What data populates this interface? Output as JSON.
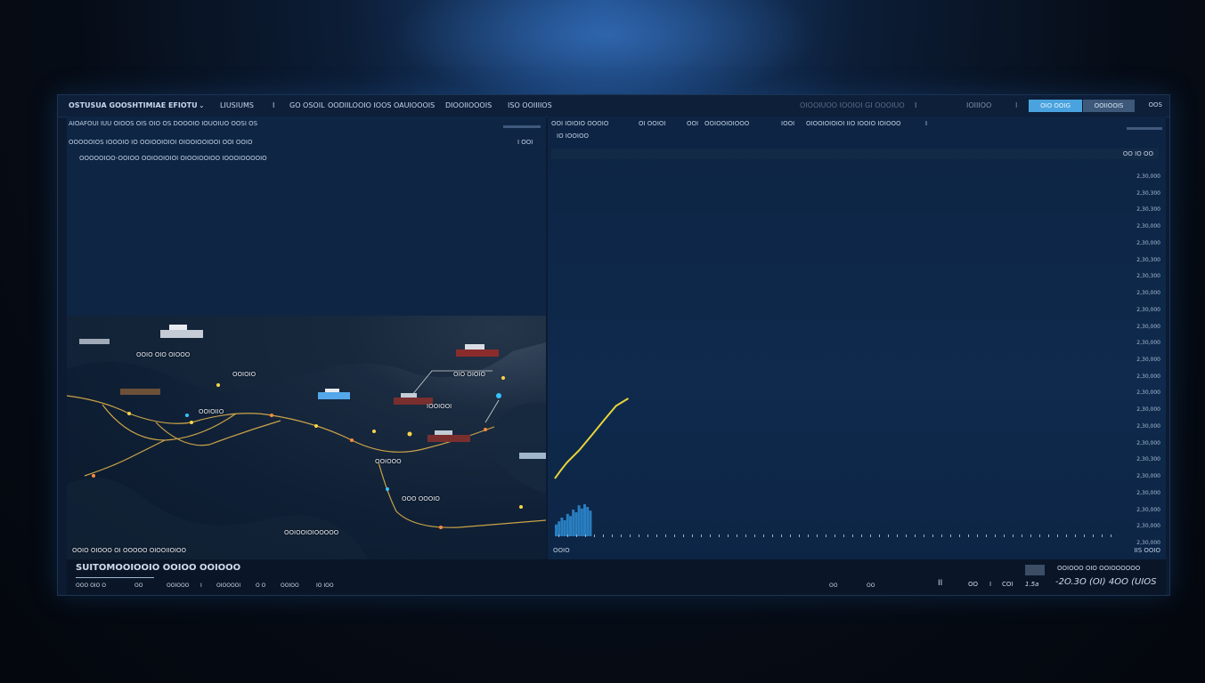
{
  "topbar": {
    "app_title": "OSTUSUA GOOSHTIMIAE EFIOTU",
    "menu_items": [
      "LIUSIUMS",
      "I",
      "GO OSOIL",
      "OODIILOOIO IOOS OAUIOOOIS",
      "DIOOIIOOOIS",
      "ISO OOIIIIOS"
    ],
    "right_status": "OIOOIUOO IOOIOI GI OOOIUO",
    "right_misc": [
      "I",
      "IOIIIOO",
      "I"
    ],
    "primary_button": "OIO OOIG",
    "secondary_button": "OOIIOOIS",
    "more_label": "OOS"
  },
  "left_panel": {
    "header": "AIOAFOUI IUU OIOOS OIS OIO OS DOOOIO IOUOIUO OOSI OS",
    "subheader": "OOOOOIOS IOOOIO IO OOIOOIOIOI OIOOIOOIOOI OOI OOIO",
    "subheader_right": "I OOI",
    "detail": "OOOOOIOO-OOIOO OOIOOIOIOI OIOOIOOIOO IOOOIOOOOIO"
  },
  "map": {
    "labels": [
      "OOIO OIO OIOOO",
      "OOIOIO",
      "OOIOIIO",
      "OIO OIOIO",
      "IOOIOOI",
      "OOO OOOIO",
      "OOIOOO",
      "OOIOOIOIOOOOO",
      "OOIO OIOOO OI OOOOO OIOOIIOIOO"
    ]
  },
  "right_panel": {
    "toolbar": [
      "OOI IOIOIO OOOIO",
      "OI OOIOI",
      "OOI",
      "OOIOOIOIOOO",
      "IOOI",
      "OIOOIOIOIOI IIO IOOIO IOIOOO",
      "I"
    ],
    "subtitle": "IO IOOIOO",
    "chart_header_right": "OO IO OO",
    "x_label": "OOIO",
    "x_label_right": "IIS OOIO"
  },
  "chart_data": {
    "type": "line",
    "x": [
      0,
      5,
      10,
      20,
      30,
      40,
      50,
      60
    ],
    "y": [
      350000,
      401000,
      448000,
      522000,
      611000,
      702000,
      790000,
      835000
    ],
    "xlim": [
      0,
      460
    ],
    "ylim": [
      0,
      2220000
    ],
    "ytick_labels": [
      "2,30,000",
      "2,30,300",
      "2,30,300",
      "2,30,000",
      "2,30,000",
      "2,30,300",
      "2,30,300",
      "2,30,000",
      "2,30,000",
      "2,30,000",
      "2,30,000",
      "2,30,000",
      "2,30,000",
      "2,30,000",
      "2,30,000",
      "2,30,000",
      "2,30,000",
      "2,30,300",
      "2,30,000",
      "2,30,000",
      "2,30,000",
      "2,30,000",
      "2,30,000"
    ],
    "bars": [
      0.22,
      0.28,
      0.35,
      0.3,
      0.42,
      0.38,
      0.5,
      0.45,
      0.58,
      0.52,
      0.6,
      0.55,
      0.48
    ],
    "line_color": "#e8d43a",
    "bar_color": "#2e8ed6"
  },
  "bottom_bar": {
    "title": "SUITOMOOIOOIO OOIOO OOIOOO",
    "items": [
      "OOO OIO O",
      "OO",
      "OOIOOO",
      "I",
      "OIOOOOI",
      "O O",
      "OOIOO",
      "IO IOO"
    ],
    "right_labels": [
      "OO",
      "OO",
      "II",
      "OO",
      "I",
      "COI",
      "1.5a"
    ],
    "stat_label": "OOIOOO OIO OOIOOOOOO",
    "stat_values": "-2O.3O  (OI)  4OO  (UIOS"
  },
  "colors": {
    "accent": "#4aa3de",
    "panel": "#0e2544",
    "route": "#e0b24a"
  }
}
